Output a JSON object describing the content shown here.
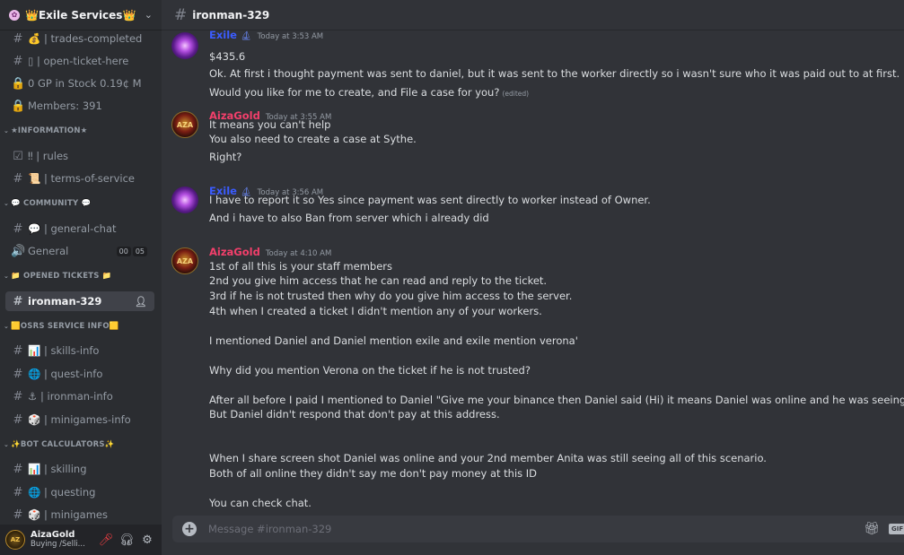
{
  "server": {
    "name": "👑Exile Services👑"
  },
  "channels": [
    {
      "type": "channel",
      "icon": "#",
      "label": "💰 | trades-completed"
    },
    {
      "type": "channel",
      "icon": "#",
      "label": "▯ | open-ticket-here"
    },
    {
      "type": "channel",
      "icon": "🔒",
      "label": "0 GP in Stock 0.19¢ M"
    },
    {
      "type": "channel",
      "icon": "🔒",
      "label": "Members: 391"
    },
    {
      "type": "category",
      "label": "★INFORMATION★"
    },
    {
      "type": "channel",
      "icon": "☑",
      "label": "‼ | rules"
    },
    {
      "type": "channel",
      "icon": "#",
      "label": "📜 | terms-of-service"
    },
    {
      "type": "category",
      "label": "💬 COMMUNITY 💬"
    },
    {
      "type": "channel",
      "icon": "#",
      "label": "💬 | general-chat"
    },
    {
      "type": "voice",
      "icon": "🔊",
      "label": "General",
      "badge": [
        "00",
        "05"
      ]
    },
    {
      "type": "category",
      "label": "📁 OPENED TICKETS 📁"
    },
    {
      "type": "channel",
      "icon": "#",
      "label": "ironman-329",
      "active": true
    },
    {
      "type": "category",
      "label": "🟨OSRS SERVICE INFO🟨"
    },
    {
      "type": "channel",
      "icon": "#",
      "label": "📊 | skills-info"
    },
    {
      "type": "channel",
      "icon": "#",
      "label": "🌐 | quest-info"
    },
    {
      "type": "channel",
      "icon": "#",
      "label": "⚓ | ironman-info"
    },
    {
      "type": "channel",
      "icon": "#",
      "label": "🎲 | minigames-info"
    },
    {
      "type": "category",
      "label": "✨BOT CALCULATORS✨"
    },
    {
      "type": "channel",
      "icon": "#",
      "label": "📊 | skilling"
    },
    {
      "type": "channel",
      "icon": "#",
      "label": "🌐 | questing"
    },
    {
      "type": "channel",
      "icon": "#",
      "label": "🎲 | minigames"
    }
  ],
  "user": {
    "name": "AizaGold",
    "status": "Buying /Selli..."
  },
  "topbar": {
    "channel": "ironman-329"
  },
  "messages": [
    {
      "author": "Exile",
      "author_type": "exile",
      "timestamp": "Today at 3:53 AM",
      "lines": [
        "$435.6",
        "Ok. At first i thought payment was sent to daniel, but it was sent to the worker directly so i wasn't sure who it was paid out to at first.",
        "Would you like for me to create, and File a case for you?"
      ],
      "edited_label": "(edited)"
    },
    {
      "author": "AizaGold",
      "author_type": "aiza",
      "timestamp": "Today at 3:55 AM",
      "lines": [
        "It means you can't help",
        "You also need to create a case at Sythe.",
        "Right?"
      ]
    },
    {
      "author": "Exile",
      "author_type": "exile",
      "timestamp": "Today at 3:56 AM",
      "lines": [
        "I have to report it so Yes since payment was sent directly to worker instead of Owner.",
        "And i have to also Ban from server which i already did"
      ]
    },
    {
      "author": "AizaGold",
      "author_type": "aiza",
      "timestamp": "Today at 4:10 AM",
      "lines": [
        "1st of all this is your staff members",
        "2nd you give him access that he can read and reply to the ticket.",
        "3rd if he is not trusted then why do you give him access to the server.",
        "4th when I created a ticket I didn't mention any of your workers.",
        "",
        "I mentioned Daniel and Daniel mention exile and exile mention verona'",
        "",
        "Why did you mention Verona on the ticket if he is not trusted?",
        "",
        "After all before I paid I mentioned to Daniel \"Give me your binance then Daniel said (Hi) it means Daniel was online and he was seeing all of this Deal.",
        "But Daniel didn't respond that don't pay at this address.",
        "",
        "",
        "When I share screen shot Daniel was online and your 2nd member Anita was still seeing all of this scenario.",
        "Both of all online they didn't say me don't pay money at this ID",
        "",
        "You can check chat."
      ]
    }
  ],
  "composer": {
    "placeholder": "Message #ironman-329",
    "gif_label": "GIF"
  },
  "colors": {
    "exile_name": "#3b5cff",
    "aiza_name": "#f23f6b",
    "active_channel": "#404249"
  }
}
